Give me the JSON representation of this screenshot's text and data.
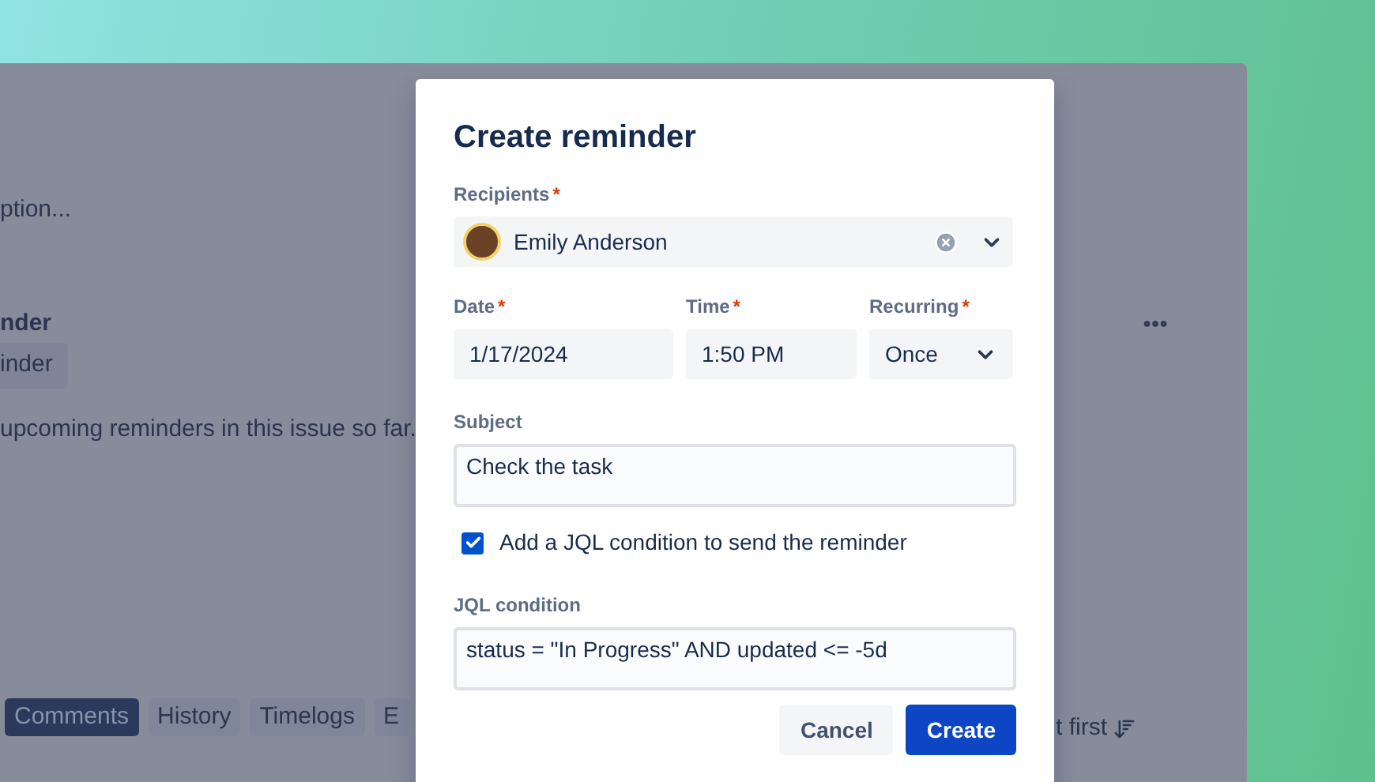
{
  "background": {
    "description_preview": "ption...",
    "reminder_heading": "nder",
    "reminder_button": "inder",
    "empty_message": "upcoming reminders in this issue so far.",
    "activity_tabs": [
      {
        "label": "Comments",
        "selected": true
      },
      {
        "label": "History",
        "selected": false
      },
      {
        "label": "Timelogs",
        "selected": false
      },
      {
        "label": "E",
        "selected": false
      }
    ],
    "sort_label": "t first"
  },
  "dialog": {
    "title": "Create reminder",
    "recipients": {
      "label": "Recipients",
      "required_mark": "*",
      "value": "Emily Anderson"
    },
    "date": {
      "label": "Date",
      "required_mark": "*",
      "value": "1/17/2024"
    },
    "time": {
      "label": "Time",
      "required_mark": "*",
      "value": "1:50 PM"
    },
    "recurring": {
      "label": "Recurring",
      "required_mark": "*",
      "value": "Once"
    },
    "subject": {
      "label": "Subject",
      "value": "Check the task"
    },
    "jql_toggle": {
      "label": "Add a JQL condition to send the reminder",
      "checked": true
    },
    "jql": {
      "label": "JQL condition",
      "value": "status = \"In Progress\" AND updated <= -5d"
    },
    "buttons": [
      {
        "label": "Cancel",
        "kind": "secondary"
      },
      {
        "label": "Create",
        "kind": "primary"
      }
    ]
  }
}
